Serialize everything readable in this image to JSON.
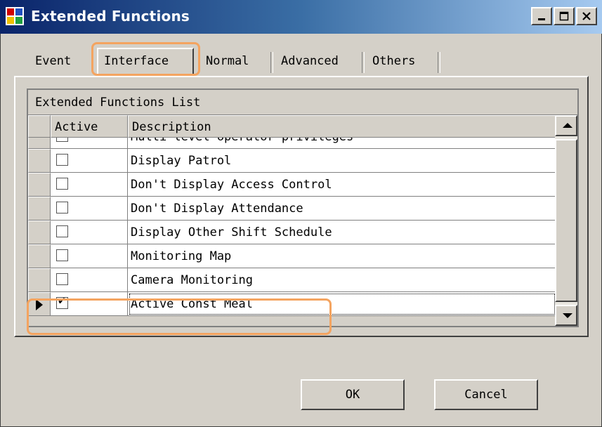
{
  "window": {
    "title": "Extended Functions",
    "controls": {
      "minimize": "_",
      "maximize": "□",
      "close": "×"
    }
  },
  "tabs": [
    {
      "label": "Event",
      "selected": false
    },
    {
      "label": "Interface",
      "selected": true
    },
    {
      "label": "Normal",
      "selected": false
    },
    {
      "label": "Advanced",
      "selected": false
    },
    {
      "label": "Others",
      "selected": false
    }
  ],
  "grid": {
    "caption": "Extended Functions List",
    "columns": {
      "active": "Active",
      "description": "Description"
    },
    "rows": [
      {
        "active": false,
        "description": "Multi-level operator privileges"
      },
      {
        "active": false,
        "description": "Display Patrol"
      },
      {
        "active": false,
        "description": "Don't Display Access Control"
      },
      {
        "active": false,
        "description": "Don't Display Attendance"
      },
      {
        "active": false,
        "description": "Display Other Shift Schedule"
      },
      {
        "active": false,
        "description": "Monitoring Map"
      },
      {
        "active": false,
        "description": "Camera Monitoring"
      },
      {
        "active": true,
        "description": "Active Const Meal",
        "current": true
      }
    ]
  },
  "buttons": {
    "ok": "OK",
    "cancel": "Cancel"
  },
  "colors": {
    "titlebar_start": "#0a246a",
    "titlebar_end": "#a6caf0",
    "highlight": "#f4a460",
    "face": "#d4d0c8"
  }
}
